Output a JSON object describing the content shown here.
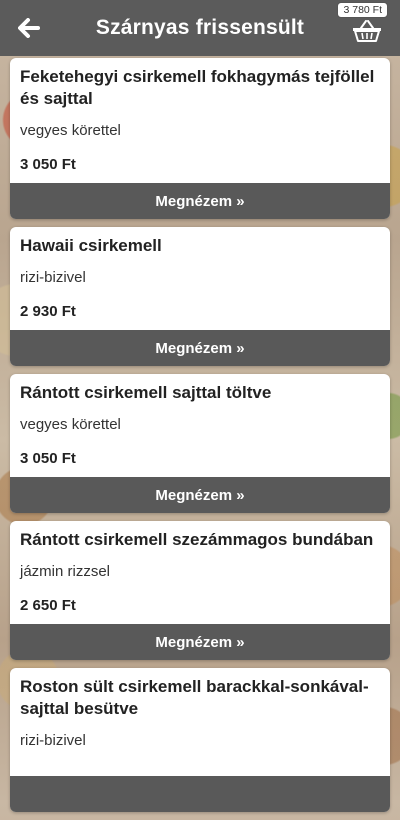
{
  "header": {
    "title": "Szárnyas frissensült",
    "cart_total": "3 780 Ft",
    "back_icon": "arrow-left-icon",
    "cart_icon": "basket-icon"
  },
  "items": [
    {
      "name": "Feketehegyi csirkemell fokhagymás tejföllel és sajttal",
      "side": "vegyes körettel",
      "price": "3 050 Ft",
      "button": "Megnézem »"
    },
    {
      "name": "Hawaii csirkemell",
      "side": "rizi-bizivel",
      "price": "2 930 Ft",
      "button": "Megnézem »"
    },
    {
      "name": "Rántott csirkemell sajttal töltve",
      "side": "vegyes körettel",
      "price": "3 050 Ft",
      "button": "Megnézem »"
    },
    {
      "name": "Rántott csirkemell szezámmagos bundában",
      "side": "jázmin rizzsel",
      "price": "2 650 Ft",
      "button": "Megnézem »"
    },
    {
      "name": "Roston sült csirkemell barackkal-sonkával-sajttal besütve",
      "side": "rizi-bizivel",
      "price": "",
      "button": ""
    }
  ]
}
